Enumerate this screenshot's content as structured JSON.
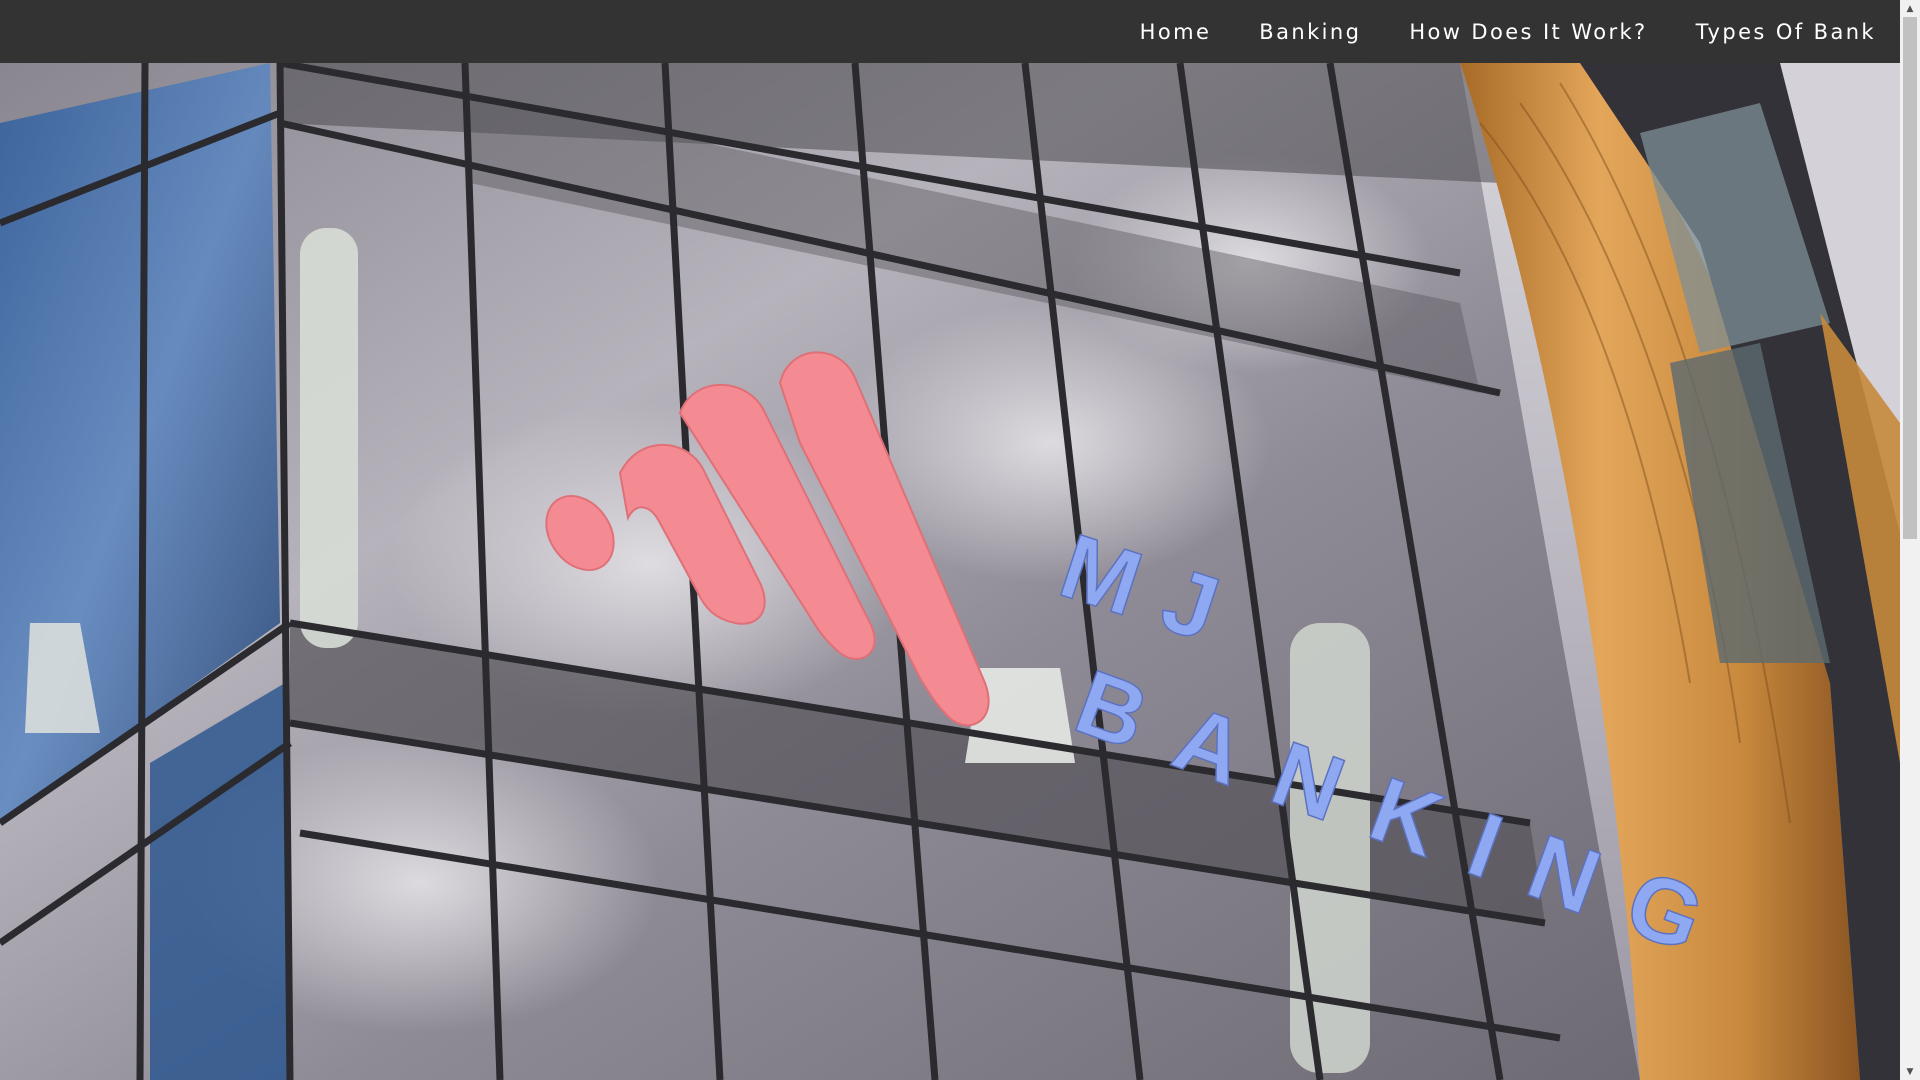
{
  "nav": {
    "items": [
      {
        "label": "Home",
        "name": "nav-home"
      },
      {
        "label": "Banking",
        "name": "nav-banking"
      },
      {
        "label": "How Does It Work?",
        "name": "nav-how-does-it-work"
      },
      {
        "label": "Types Of Bank",
        "name": "nav-types-of-bank"
      }
    ]
  },
  "hero": {
    "sign_line1": "MJ",
    "sign_line2": "BANKING",
    "logo_color": "#f48b92",
    "sign_text_color": "#8fa8f2"
  },
  "colors": {
    "navbar_bg": "#333333",
    "nav_text": "#ffffff"
  },
  "icons": {
    "scroll_up": "scroll-up-arrow-icon",
    "scroll_down": "scroll-down-arrow-icon"
  }
}
